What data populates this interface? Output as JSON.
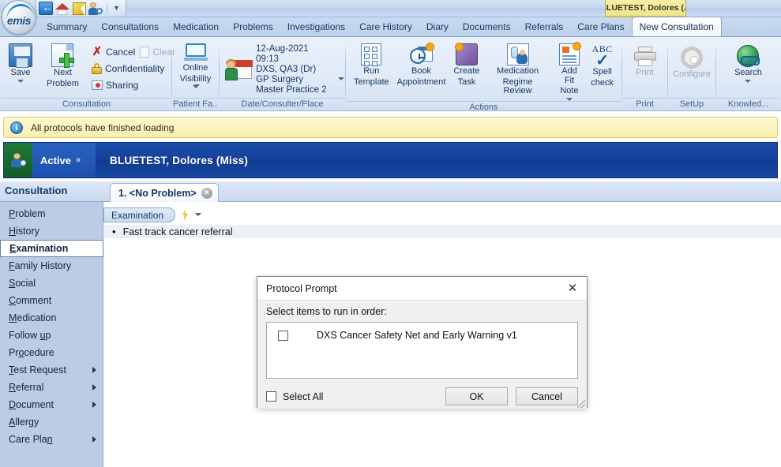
{
  "titlebar": {
    "patient_tab": "BLUETEST, Dolores (...",
    "qat": [
      {
        "name": "back-icon",
        "label": "Back"
      },
      {
        "name": "home-icon",
        "label": "Home"
      },
      {
        "name": "edit-icon",
        "label": "Edit"
      },
      {
        "name": "find-patient-icon",
        "label": "Find Patient"
      }
    ],
    "qat_more": "▼"
  },
  "logo": {
    "text": "emis"
  },
  "nav_tabs": [
    {
      "label": "Summary",
      "active": false
    },
    {
      "label": "Consultations",
      "active": false
    },
    {
      "label": "Medication",
      "active": false
    },
    {
      "label": "Problems",
      "active": false
    },
    {
      "label": "Investigations",
      "active": false
    },
    {
      "label": "Care History",
      "active": false
    },
    {
      "label": "Diary",
      "active": false
    },
    {
      "label": "Documents",
      "active": false
    },
    {
      "label": "Referrals",
      "active": false
    },
    {
      "label": "Care Plans",
      "active": false
    },
    {
      "label": "New Consultation",
      "active": true
    }
  ],
  "ribbon": {
    "groups": [
      {
        "name": "consultation",
        "label": "Consultation",
        "big_buttons": [
          {
            "label": "Save",
            "icon": "save-icon",
            "has_caret": true
          },
          {
            "label": "Next\nProblem",
            "line1": "Next",
            "line2": "Problem",
            "icon": "new-problem-icon",
            "has_caret": false
          }
        ],
        "small_buttons": [
          {
            "label": "Cancel",
            "icon": "cancel-icon",
            "disabled": false
          },
          {
            "label": "Clear",
            "icon": "clear-icon",
            "disabled": true
          },
          {
            "label": "Confidentiality",
            "icon": "lock-icon",
            "disabled": false
          },
          {
            "label": "Sharing",
            "icon": "sharing-icon",
            "disabled": false,
            "has_caret": true
          }
        ]
      },
      {
        "name": "patient-facilities",
        "label": "Patient Fa...",
        "big_buttons": [
          {
            "line1": "Online",
            "line2": "Visibility",
            "icon": "monitor-icon",
            "has_caret": true
          }
        ]
      },
      {
        "name": "date-consulter-place",
        "label": "Date/Consulter/Place",
        "icon": "consulter-icon",
        "lines": [
          "12-Aug-2021 09:13",
          "DXS, QA3 (Dr)",
          "GP Surgery",
          "Master Practice 2"
        ],
        "has_caret": true
      },
      {
        "name": "actions",
        "label": "Actions",
        "big_buttons": [
          {
            "line1": "Run",
            "line2": "Template",
            "icon": "template-icon"
          },
          {
            "line1": "Book",
            "line2": "Appointment",
            "icon": "appointment-icon"
          },
          {
            "line1": "Create",
            "line2": "Task",
            "icon": "task-icon"
          },
          {
            "line1": "Medication",
            "line2": "Regime Review",
            "icon": "medication-review-icon"
          },
          {
            "line1": "Add Fit",
            "line2": "Note",
            "icon": "fit-note-icon",
            "has_caret": true
          },
          {
            "line1": "Spell",
            "line2": "check",
            "icon": "spell-check-icon"
          }
        ]
      },
      {
        "name": "print",
        "label": "Print",
        "big_buttons": [
          {
            "label": "Print",
            "icon": "printer-icon",
            "disabled": true
          }
        ]
      },
      {
        "name": "setup",
        "label": "SetUp",
        "big_buttons": [
          {
            "label": "Configure",
            "icon": "gear-icon",
            "disabled": true
          }
        ]
      },
      {
        "name": "knowledge",
        "label": "Knowled...",
        "big_buttons": [
          {
            "label": "Search",
            "icon": "globe-search-icon",
            "has_caret": true
          }
        ]
      }
    ]
  },
  "notification": {
    "icon": "info-icon",
    "icon_glyph": "i",
    "message": "All protocols have finished loading"
  },
  "patient_banner": {
    "status": "Active",
    "chevron": "»",
    "name": "BLUETEST,  Dolores  (Miss)",
    "person_icon": "patient-icon"
  },
  "workspace": {
    "title": "Consultation",
    "problem_tab": {
      "label": "1. <No Problem>",
      "close_glyph": "×"
    },
    "sidebar": [
      {
        "label": "Problem",
        "accel": "P",
        "selected": false,
        "submenu": false
      },
      {
        "label": "History",
        "accel": "H",
        "selected": false,
        "submenu": false
      },
      {
        "label": "Examination",
        "accel": "E",
        "selected": true,
        "submenu": false
      },
      {
        "label": "Family History",
        "accel": "F",
        "selected": false,
        "submenu": false
      },
      {
        "label": "Social",
        "accel": "S",
        "selected": false,
        "submenu": false
      },
      {
        "label": "Comment",
        "accel": "C",
        "selected": false,
        "submenu": false
      },
      {
        "label": "Medication",
        "accel": "M",
        "selected": false,
        "submenu": false
      },
      {
        "label": "Follow up",
        "accel": "u",
        "selected": false,
        "submenu": false
      },
      {
        "label": "Procedure",
        "accel": "o",
        "selected": false,
        "submenu": false
      },
      {
        "label": "Test Request",
        "accel": "T",
        "selected": false,
        "submenu": true
      },
      {
        "label": "Referral",
        "accel": "R",
        "selected": false,
        "submenu": true
      },
      {
        "label": "Document",
        "accel": "D",
        "selected": false,
        "submenu": true
      },
      {
        "label": "Allergy",
        "accel": "A",
        "selected": false,
        "submenu": false
      },
      {
        "label": "Care Plan",
        "accel": "n",
        "selected": false,
        "submenu": true
      }
    ],
    "section": {
      "label": "Examination",
      "bolt_icon": "protocol-bolt-icon",
      "entries": [
        {
          "bullet": "•",
          "text": "Fast track cancer referral"
        }
      ]
    }
  },
  "dialog": {
    "title": "Protocol Prompt",
    "close_glyph": "✕",
    "subtitle": "Select items to run in order:",
    "items": [
      {
        "label": "DXS Cancer Safety Net and Early Warning v1",
        "checked": false
      }
    ],
    "select_all_label": "Select All",
    "select_all_checked": false,
    "ok_label": "OK",
    "cancel_label": "Cancel"
  }
}
